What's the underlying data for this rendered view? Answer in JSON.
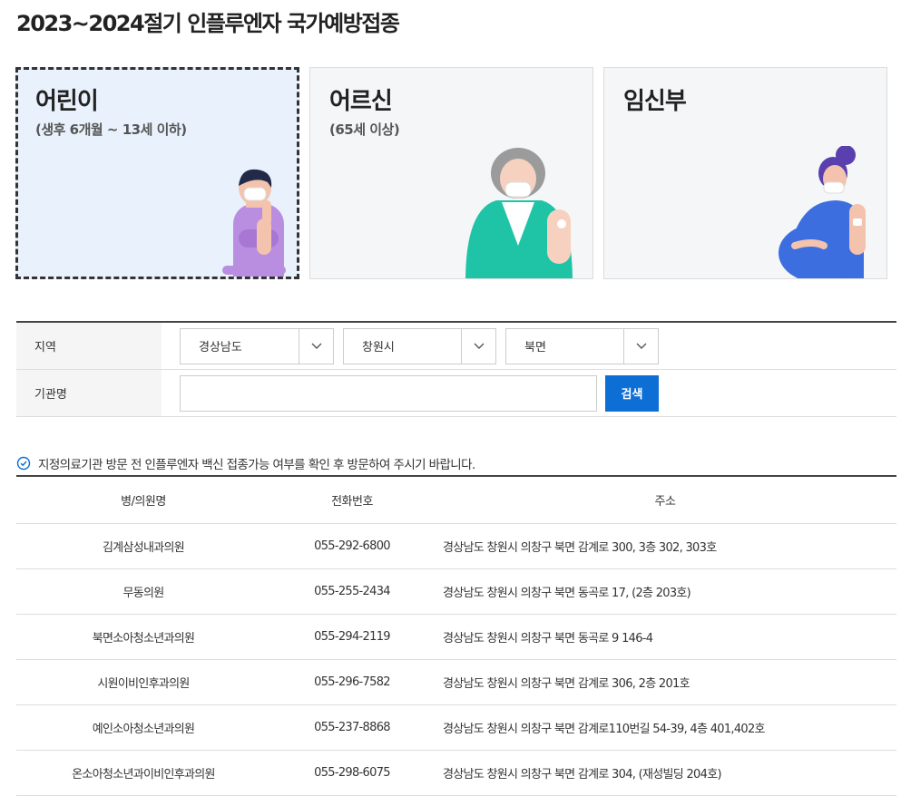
{
  "page_title": "2023~2024절기 인플루엔자 국가예방접종",
  "cards": [
    {
      "title": "어린이",
      "subtitle": "(생후 6개월 ~ 13세 이하)",
      "selected": true
    },
    {
      "title": "어르신",
      "subtitle": "(65세 이상)",
      "selected": false
    },
    {
      "title": "임신부",
      "subtitle": "",
      "selected": false
    }
  ],
  "search_form": {
    "region_label": "지역",
    "province": "경상남도",
    "city": "창원시",
    "district": "북면",
    "institution_label": "기관명",
    "institution_value": "",
    "search_button": "검색"
  },
  "notice": "지정의료기관 방문 전 인플루엔자 백신 접종가능 여부를 확인 후 방문하여 주시기 바랍니다.",
  "table": {
    "headers": [
      "병/의원명",
      "전화번호",
      "주소"
    ],
    "rows": [
      [
        "김계삼성내과의원",
        "055-292-6800",
        "경상남도 창원시 의창구 북면 감계로 300, 3층 302, 303호"
      ],
      [
        "무동의원",
        "055-255-2434",
        "경상남도 창원시 의창구 북면 동곡로 17, (2층 203호)"
      ],
      [
        "북면소아청소년과의원",
        "055-294-2119",
        "경상남도 창원시 의창구 북면 동곡로 9 146-4"
      ],
      [
        "시원이비인후과의원",
        "055-296-7582",
        "경상남도 창원시 의창구 북면 감계로 306, 2층 201호"
      ],
      [
        "예인소아청소년과의원",
        "055-237-8868",
        "경상남도 창원시 의창구 북면 감계로110번길 54-39, 4층 401,402호"
      ],
      [
        "온소아청소년과이비인후과의원",
        "055-298-6075",
        "경상남도 창원시 의창구 북면 감계로 304, (재성빌딩 204호)"
      ]
    ]
  },
  "colors": {
    "accent": "#0d6fd6",
    "selected_card_bg": "#e9f2fc"
  }
}
